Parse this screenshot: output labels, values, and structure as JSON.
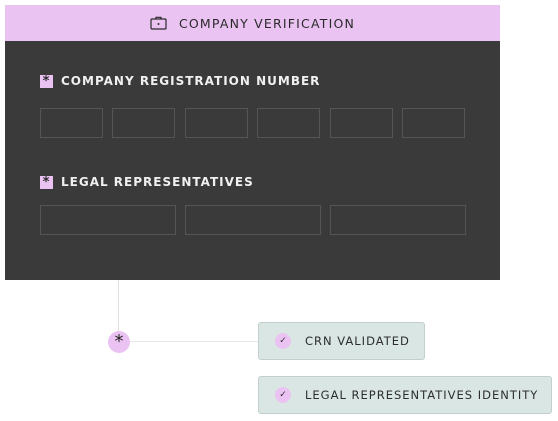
{
  "card": {
    "title": "COMPANY VERIFICATION",
    "header_icon": "briefcase-icon",
    "sections": [
      {
        "label": "COMPANY REGISTRATION NUMBER",
        "required_marker": "*",
        "field_count": 6
      },
      {
        "label": "LEGAL REPRESENTATIVES",
        "required_marker": "*",
        "field_count": 3
      }
    ]
  },
  "flow": {
    "node_symbol": "*",
    "steps": [
      {
        "label": "CRN VALIDATED",
        "icon": "check-icon",
        "check": "✓"
      },
      {
        "label": "LEGAL REPRESENTATIVES IDENTITY",
        "icon": "check-icon",
        "check": "✓"
      }
    ]
  },
  "colors": {
    "accent": "#ebc3f3",
    "card_bg": "#3a3a3a",
    "pill_bg": "#d9e6e3"
  }
}
